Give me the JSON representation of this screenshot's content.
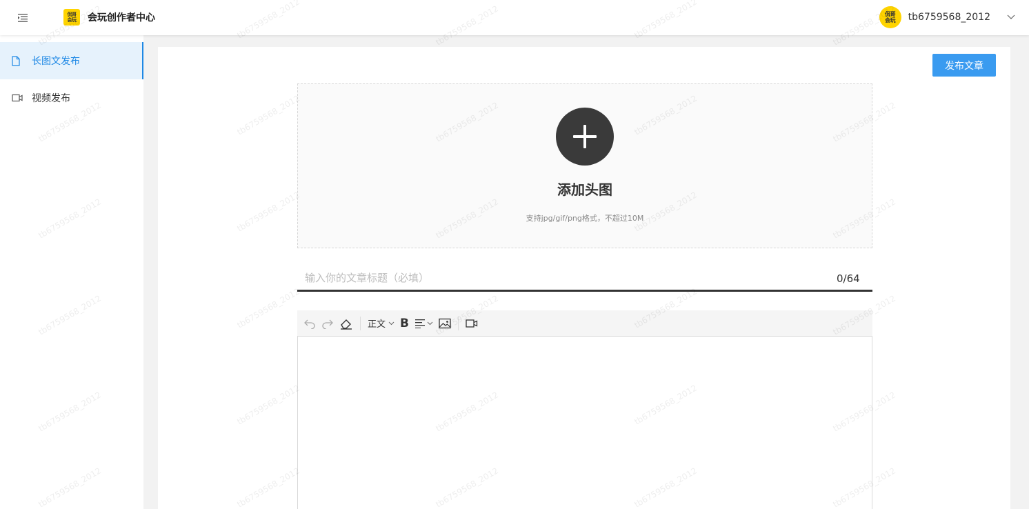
{
  "header": {
    "logo_line1": "侃哥",
    "logo_line2": "会玩",
    "app_title": "会玩创作者中心",
    "avatar_line1": "侃哥",
    "avatar_line2": "会玩",
    "username": "tb6759568_2012"
  },
  "sidebar": {
    "items": [
      {
        "label": "长图文发布",
        "icon": "document-icon",
        "active": true
      },
      {
        "label": "视频发布",
        "icon": "video-camera-icon",
        "active": false
      }
    ]
  },
  "main": {
    "publish_button": "发布文章",
    "upload": {
      "title": "添加头图",
      "hint": "支持jpg/gif/png格式，不超过10M"
    },
    "title_input": {
      "placeholder": "输入你的文章标题（必填）",
      "value": "",
      "count": "0/64"
    },
    "toolbar": {
      "paragraph_style": "正文",
      "bold": "B"
    }
  },
  "watermark_text": "tb6759568_2012",
  "colors": {
    "accent": "#1e88e5",
    "publish_button": "#3a9bf0",
    "logo_yellow": "#ffd400"
  }
}
